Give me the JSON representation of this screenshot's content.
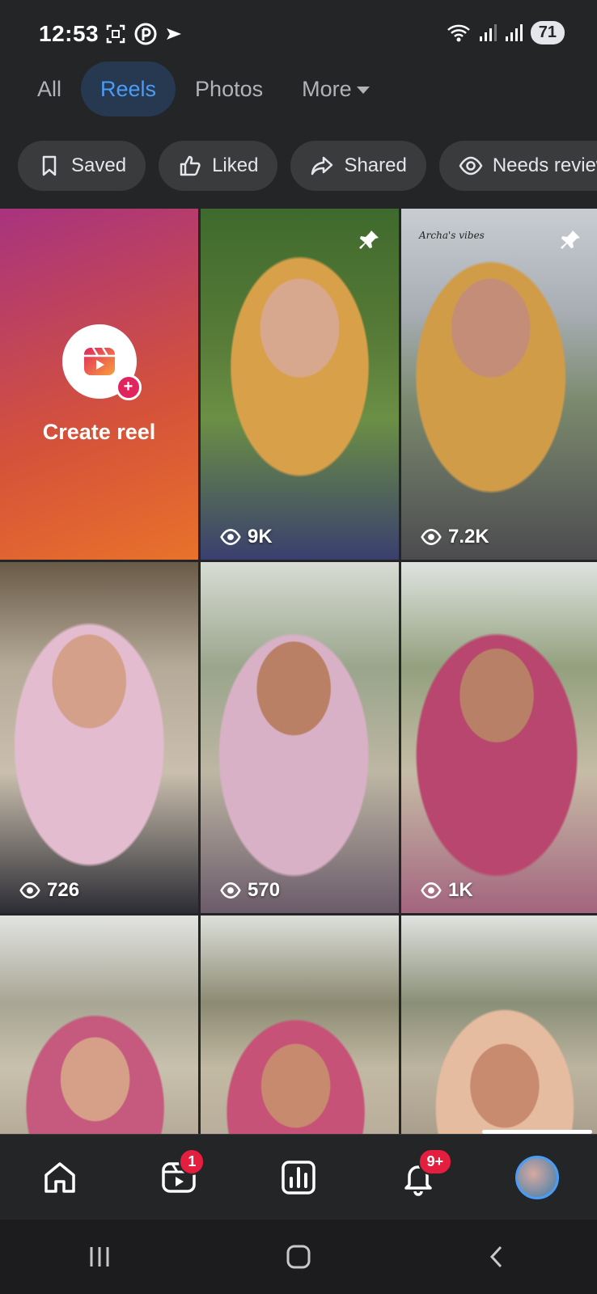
{
  "status_bar": {
    "time": "12:53",
    "battery": "71"
  },
  "top_tabs": [
    {
      "label": "All",
      "active": false
    },
    {
      "label": "Reels",
      "active": true
    },
    {
      "label": "Photos",
      "active": false
    },
    {
      "label": "More",
      "active": false
    }
  ],
  "filter_chips": [
    {
      "label": "Saved",
      "icon": "bookmark-icon"
    },
    {
      "label": "Liked",
      "icon": "thumbs-up-icon"
    },
    {
      "label": "Shared",
      "icon": "share-icon"
    },
    {
      "label": "Needs review",
      "icon": "eye-icon"
    }
  ],
  "create_reel": {
    "label": "Create reel"
  },
  "reels": [
    {
      "views": "9K",
      "pinned": true,
      "overlay_text": ""
    },
    {
      "views": "7.2K",
      "pinned": true,
      "overlay_text": "Archa's vibes"
    },
    {
      "views": "726",
      "pinned": false,
      "overlay_text": ""
    },
    {
      "views": "570",
      "pinned": false,
      "overlay_text": ""
    },
    {
      "views": "1K",
      "pinned": false,
      "overlay_text": ""
    },
    {
      "views": "",
      "pinned": false,
      "overlay_text": ""
    },
    {
      "views": "",
      "pinned": false,
      "overlay_text": ""
    },
    {
      "views": "",
      "pinned": false,
      "overlay_text": ""
    }
  ],
  "bottom_nav": {
    "reels_badge": "1",
    "notifications_badge": "9+"
  },
  "colors": {
    "background": "#242527",
    "accent": "#4b9cf7",
    "badge": "#e41e3f"
  }
}
